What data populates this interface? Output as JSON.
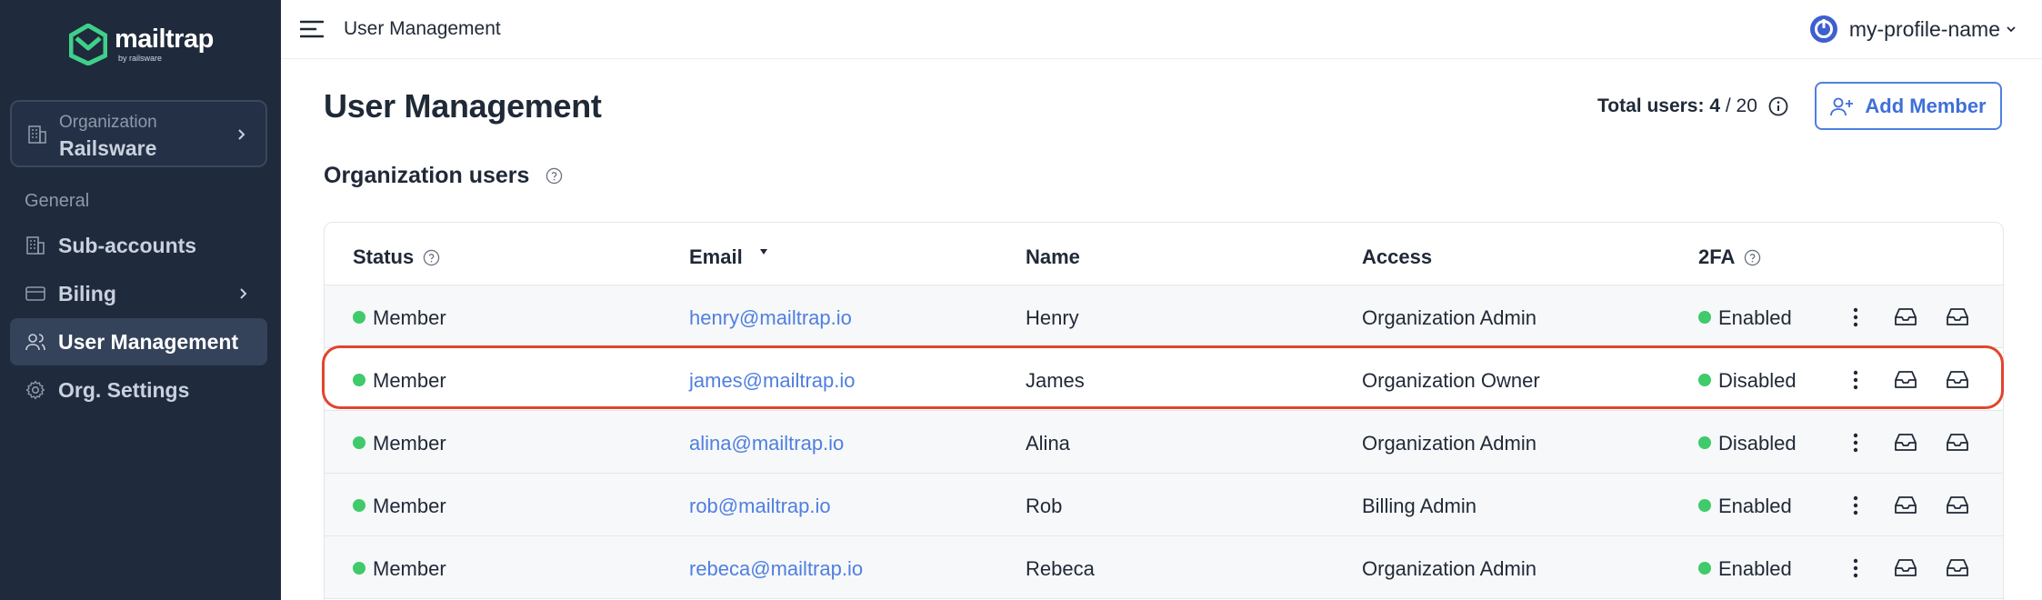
{
  "app": {
    "logo_name": "mailtrap",
    "logo_sub": "by railsware"
  },
  "sidebar": {
    "org_label": "Organization",
    "org_name": "Railsware",
    "section_label": "General",
    "items": [
      {
        "label": "Sub-accounts",
        "icon": "building-icon"
      },
      {
        "label": "Biling",
        "icon": "billing-card-icon"
      },
      {
        "label": "User Management",
        "icon": "users-icon",
        "active": true
      },
      {
        "label": "Org. Settings",
        "icon": "gear-icon"
      }
    ]
  },
  "topbar": {
    "title": "User Management",
    "profile_name": "my-profile-name"
  },
  "main": {
    "title": "User Management",
    "total_label": "Total users:",
    "total_count": "4",
    "total_max": "/ 20",
    "add_button": "Add Member",
    "section_title": "Organization users"
  },
  "table": {
    "headers": {
      "status": "Status",
      "email": "Email",
      "name": "Name",
      "access": "Access",
      "twofa": "2FA"
    },
    "rows": [
      {
        "status": "Member",
        "email": "henry@mailtrap.io",
        "name": "Henry",
        "access": "Organization Admin",
        "twofa": "Enabled"
      },
      {
        "status": "Member",
        "email": "james@mailtrap.io",
        "name": "James",
        "access": "Organization Owner",
        "twofa": "Disabled"
      },
      {
        "status": "Member",
        "email": "alina@mailtrap.io",
        "name": "Alina",
        "access": "Organization Admin",
        "twofa": "Disabled"
      },
      {
        "status": "Member",
        "email": "rob@mailtrap.io",
        "name": "Rob",
        "access": "Billing Admin",
        "twofa": "Enabled"
      },
      {
        "status": "Member",
        "email": "rebeca@mailtrap.io",
        "name": "Rebeca",
        "access": "Organization Admin",
        "twofa": "Enabled"
      }
    ]
  },
  "colors": {
    "sidebar_bg": "#1f2a3c",
    "accent": "#4f7fe0",
    "status_green": "#3fca6b",
    "highlight_red": "#e2452c"
  }
}
